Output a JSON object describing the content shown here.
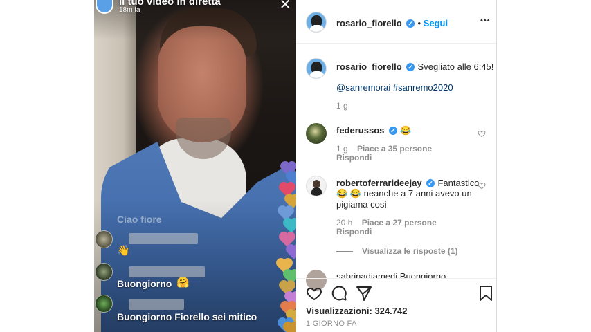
{
  "video": {
    "title": "Il tuo video in diretta",
    "time": "18m fa",
    "ghost_comment": "Ciao fiore",
    "comments": [
      {
        "text": "",
        "emoji": "👋"
      },
      {
        "text": "Buongiorno",
        "emoji": "🤗"
      },
      {
        "text": "Buongiorno Fiorello sei mitico",
        "emoji": ""
      }
    ]
  },
  "post": {
    "author": "rosario_fiorello",
    "follow_label": "Segui",
    "more_label": "•••",
    "caption": "Svegliato alle 6:45!",
    "tags": "@sanremorai #sanremo2020",
    "caption_time": "1 g",
    "comments": [
      {
        "user": "federussos",
        "text": "😂",
        "time": "1 g",
        "likes": "Piace a 35 persone",
        "reply": "Rispondi"
      },
      {
        "user": "robertoferrarideejay",
        "text": "Fantastico",
        "text2": "😂 😂  neanche a 7 anni avevo un",
        "text3": "pigiama così",
        "time": "20 h",
        "likes": "Piace a 27 persone",
        "reply": "Rispondi"
      }
    ],
    "view_replies": "Visualizza le risposte (1)",
    "cut_comment": "sabrinadiamedi Buongiorno",
    "views_label": "Visualizzazioni: 324.742",
    "date": "1 GIORNO FA"
  },
  "colors": {
    "accent": "#0095f6",
    "verified": "#3897f0",
    "muted": "#8e8e8e",
    "shirt": "#4e78b6"
  },
  "hearts_colors": [
    "#7b68c8",
    "#4f7fd0",
    "#e24a68",
    "#d4a33a",
    "#6e9ad8",
    "#3cb9c4",
    "#d56aa0",
    "#8e6bd1",
    "#e9b44c",
    "#5fbf6c",
    "#c9a24a",
    "#c37fd3",
    "#e47d4b",
    "#d4ab3f",
    "#4b8fd8",
    "#c99430"
  ]
}
